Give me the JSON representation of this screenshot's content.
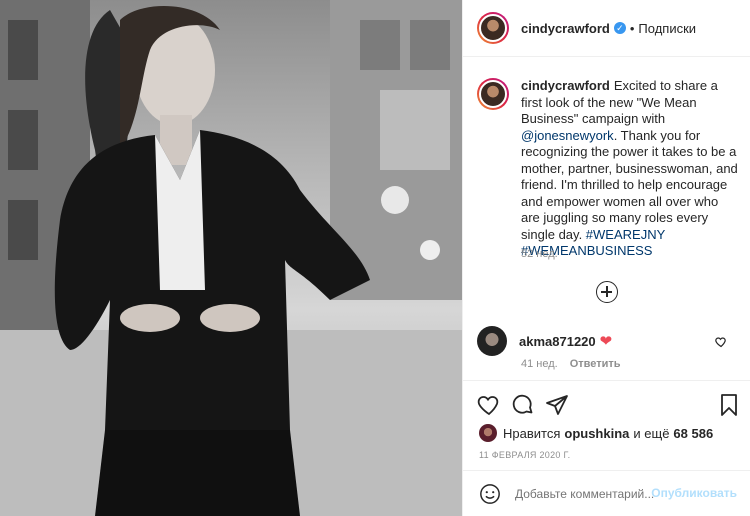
{
  "header": {
    "username": "cindycrawford",
    "separator": "•",
    "follow_label": "Подписки"
  },
  "caption": {
    "username": "cindycrawford",
    "text_1": "Excited to share a first look of the new \"We Mean Business\" campaign with ",
    "mention": "@jonesnewyork",
    "text_2": ". Thank you for recognizing the power it takes to be a mother, partner, businesswoman, and friend. I'm thrilled to help encourage and empower women all over who are juggling so many roles every single day. ",
    "hashtags": "#WEAREJNY #WEMEANBUSINESS",
    "time": "52 нед."
  },
  "comment": {
    "username": "akma871220",
    "heart": "❤",
    "time": "41 нед.",
    "reply_label": "Ответить"
  },
  "likes": {
    "prefix": "Нравится",
    "user": "opushkina",
    "conj": "и ещё",
    "count": "68 586"
  },
  "date": "11 ФЕВРАЛЯ 2020 Г.",
  "add_comment": {
    "placeholder": "Добавьте комментарий...",
    "publish_label": "Опубликовать"
  }
}
